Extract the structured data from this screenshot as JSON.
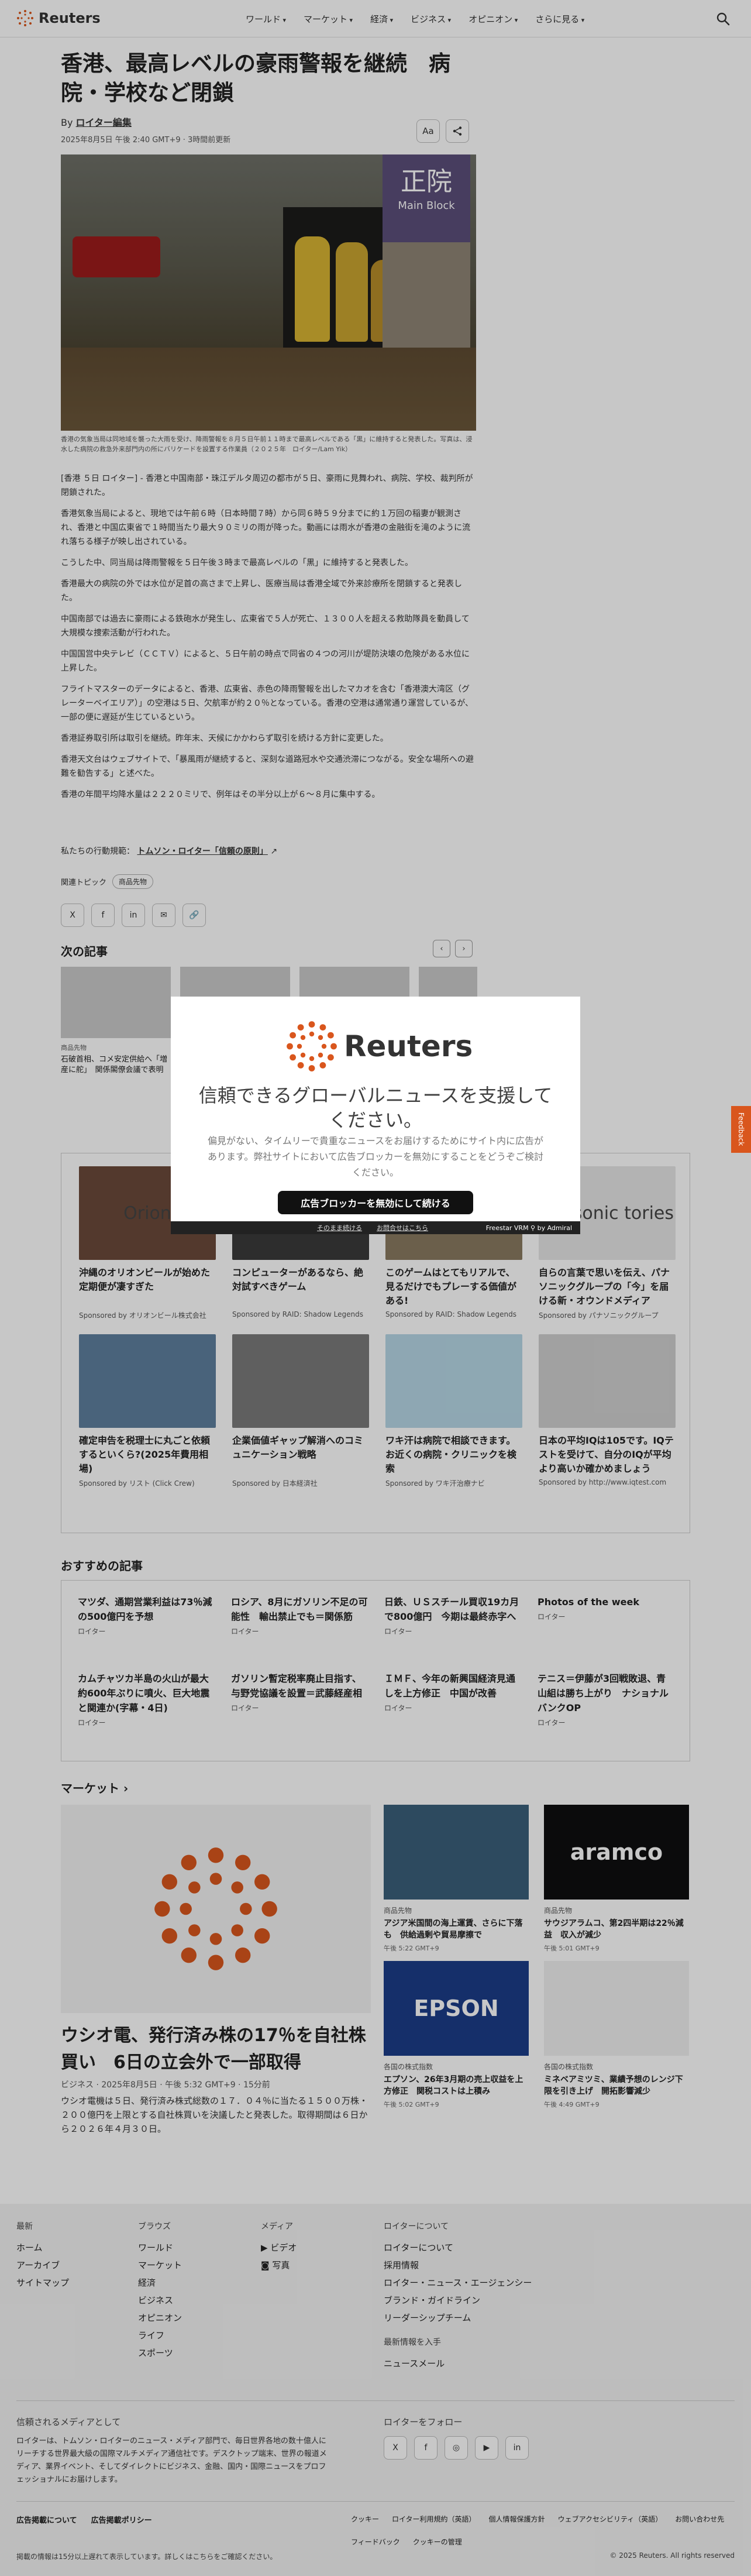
{
  "header": {
    "logo": "Reuters",
    "menu": [
      "ワールド",
      "マーケット",
      "経済",
      "ビジネス",
      "オピニオン",
      "さらに見る"
    ]
  },
  "article": {
    "title": "香港、最高レベルの豪雨警報を継続　病院・学校など閉鎖",
    "by": "By",
    "author": "ロイター編集",
    "date": "2025年8月5日 午後 2:40 GMT+9 · 3時間前更新",
    "text_size": "Aa",
    "caption": "香港の気象当局は同地域を襲った大雨を受け、降雨警報を８月５日午前１１時まで最高レベルである「黒」に維持すると発表した。写真は、浸水した病院の救急外来部門内の所にバリケードを設置する作業員（２０２５年　ロイター/Lam Yik）",
    "paragraphs": [
      "[香港 ５日 ロイター] - 香港と中国南部・珠江デルタ周辺の都市が５日、豪雨に見舞われ、病院、学校、裁判所が閉鎖された。",
      "香港気象当局によると、現地では午前６時（日本時間７時）から同６時５９分までに約１万回の稲妻が観測され、香港と中国広東省で１時間当たり最大９０ミリの雨が降った。動画には雨水が香港の金融街を滝のように流れ落ちる様子が映し出されている。",
      "こうした中、同当局は降雨警報を５日午後３時まで最高レベルの「黒」に維持すると発表した。",
      "香港最大の病院の外では水位が足首の高さまで上昇し、医療当局は香港全域で外来診療所を閉鎖すると発表した。",
      "中国南部では過去に豪雨による鉄砲水が発生し、広東省で５人が死亡、１３００人を超える救助隊員を動員して大規模な捜索活動が行われた。",
      "中国国営中央テレビ（ＣＣＴＶ）によると、５日午前の時点で同省の４つの河川が堤防決壊の危険がある水位に上昇した。",
      "フライトマスターのデータによると、香港、広東省、赤色の降雨警報を出したマカオを含む「香港澳大湾区（グレーターベイエリア）」の空港は５日、欠航率が約２０％となっている。香港の空港は通常通り運営しているが、一部の便に遅延が生じているという。",
      "香港証券取引所は取引を継続。昨年末、天候にかかわらず取引を続ける方針に変更した。",
      "香港天文台はウェブサイトで、「暴風雨が継続すると、深刻な道路冠水や交通渋滞につながる。安全な場所への避難を勧告する」と述べた。",
      "香港の年間平均降水量は２２２０ミリで、例年はその半分以上が６～８月に集中する。"
    ],
    "trust_prefix": "私たちの行動規範：",
    "trust_link": "トムソン・ロイター「信頼の原則」",
    "topics_label": "関連トピック",
    "topic": "商品先物",
    "share_icons": [
      "X",
      "f",
      "in",
      "✉",
      "🔗"
    ]
  },
  "next": {
    "heading": "次の記事",
    "cards": [
      {
        "kicker": "商品先物",
        "title": "石破首相、コメ安定供給へ「増産に舵」　関係閣僚会議で表明"
      },
      {
        "kicker": "",
        "title": ""
      },
      {
        "kicker": "",
        "title": ""
      },
      {
        "kicker": "",
        "title": ""
      }
    ]
  },
  "ads": [
    {
      "title": "沖縄のオリオンビールが始めた定期便が凄すぎた",
      "sponsor": "Sponsored by オリオンビール株式会社",
      "color": "#6b4a3a",
      "label": "Orion"
    },
    {
      "title": "コンピューターがあるなら、絶対試すべきゲーム",
      "sponsor": "Sponsored by RAID: Shadow Legends",
      "color": "#3a3a3a",
      "label": ""
    },
    {
      "title": "このゲームはとてもリアルで、見るだけでもプレーする価値がある!",
      "sponsor": "Sponsored by RAID: Shadow Legends",
      "color": "#8a7a60",
      "label": ""
    },
    {
      "title": "自らの言葉で思いを伝え、パナソニックグループの「今」を届ける新・オウンドメディア",
      "sponsor": "Sponsored by パナソニックグループ",
      "color": "#e6e6e6",
      "label": "anasonic tories"
    },
    {
      "title": "確定申告を税理士に丸ごと依頼するといくら?(2025年費用相場)",
      "sponsor": "Sponsored by リスト (Click Crew)",
      "color": "#5e7f9e",
      "label": ""
    },
    {
      "title": "企業価値ギャップ解消へのコミュニケーション戦略",
      "sponsor": "Sponsored by 日本経済社",
      "color": "#7a7a7a",
      "label": ""
    },
    {
      "title": "ワキ汗は病院で相談できます。お近くの病院・クリニックを検索",
      "sponsor": "Sponsored by ワキ汗治療ナビ",
      "color": "#b6d7e6",
      "label": ""
    },
    {
      "title": "日本の平均IQは105です。IQテストを受けて、自分のIQが平均より高いか確かめましょう",
      "sponsor": "Sponsored by http://www.iqtest.com",
      "color": "#cfcfcf",
      "label": ""
    }
  ],
  "recs": {
    "heading": "おすすめの記事",
    "items": [
      {
        "title": "マツダ、通期営業利益は73％減の500億円を予想",
        "source": "ロイター"
      },
      {
        "title": "ロシア、8月にガソリン不足の可能性　輸出禁止でも＝関係筋",
        "source": "ロイター"
      },
      {
        "title": "日鉄、ＵＳスチール買収19カ月で800億円　今期は最終赤字へ",
        "source": "ロイター"
      },
      {
        "title": "Photos of the week",
        "source": "ロイター"
      },
      {
        "title": "カムチャツカ半島の火山が最大約600年ぶりに噴火、巨大地震と関連か(字幕・4日)",
        "source": "ロイター"
      },
      {
        "title": "ガソリン暫定税率廃止目指す、与野党協議を設置＝武藤経産相",
        "source": "ロイター"
      },
      {
        "title": "ＩＭＦ、今年の新興国経済見通しを上方修正　中国が改善",
        "source": "ロイター"
      },
      {
        "title": "テニス＝伊藤が3回戦敗退、青山組は勝ち上がり　ナショナルバンクOP",
        "source": "ロイター"
      }
    ]
  },
  "markets": {
    "heading": "マーケット ›",
    "main_title": "ウシオ電、発行済み株の17％を自社株買い　6日の立会外で一部取得",
    "main_meta": "ビジネス · 2025年8月5日 · 午後 5:32 GMT+9 · 15分前",
    "main_desc": "ウシオ電機は５日、発行済み株式総数の１７．０４％に当たる１５００万株・２００億円を上限とする自社株買いを決議したと発表した。取得期間は６日から２０２６年４月３０日。",
    "cards": [
      {
        "kicker": "商品先物",
        "title": "アジア米国間の海上運賃、さらに下落も　供給過剰や貿易摩擦で",
        "date": "午後 5:22 GMT+9",
        "color": "#3a5f7a",
        "label": ""
      },
      {
        "kicker": "商品先物",
        "title": "サウジアラムコ、第2四半期は22％減益　収入が減少",
        "date": "午後 5:01 GMT+9",
        "color": "#0f0f10",
        "label": "aramco"
      },
      {
        "kicker": "各国の株式指数",
        "title": "エプソン、26年3月期の売上収益を上方修正　関税コストは上積み",
        "date": "午後 5:02 GMT+9",
        "color": "#1c3d88",
        "label": "EPSON"
      },
      {
        "kicker": "各国の株式指数",
        "title": "ミネベアミツミ、業績予想のレンジ下限を引き上げ　開拓影響減少",
        "date": "午後 4:49 GMT+9",
        "color": "#f0f0f0",
        "label": ""
      }
    ]
  },
  "footer": {
    "col1": {
      "title": "最新",
      "links": [
        "ホーム",
        "アーカイブ",
        "サイトマップ"
      ]
    },
    "col2": {
      "title": "ブラウズ",
      "links": [
        "ワールド",
        "マーケット",
        "経済",
        "ビジネス",
        "オピニオン",
        "ライフ",
        "スポーツ"
      ]
    },
    "col3": {
      "title": "メディア",
      "links": [
        "ビデオ",
        "写真"
      ]
    },
    "col4": {
      "title": "ロイターについて",
      "links": [
        "ロイターについて",
        "採用情報",
        "ロイター・ニュース・エージェンシー",
        "ブランド・ガイドライン",
        "リーダーシップチーム"
      ]
    },
    "col4b": {
      "title": "最新情報を入手",
      "links": [
        "ニュースメール"
      ]
    },
    "trust_title": "信頼されるメディアとして",
    "trust_text": "ロイターは、トムソン・ロイターのニュース・メディア部門で、毎日世界各地の数十億人にリーチする世界最大級の国際マルチメディア通信社です。デスクトップ端末、世界の報道メディア、業界イベント、そしてダイレクトにビジネス、金融、国内・国際ニュースをプロフェッショナルにお届けします。",
    "follow_title": "ロイターをフォロー",
    "follow_icons": [
      "X",
      "f",
      "◎",
      "▶",
      "in"
    ],
    "legal1": [
      "広告掲載について",
      "広告掲載ポリシー"
    ],
    "legal2": [
      "クッキー",
      "ロイター利用規約（英語）",
      "個人情報保護方針",
      "ウェブアクセシビリティ（英語）",
      "お問い合わせ先",
      "フィードバック",
      "クッキーの管理"
    ],
    "note": "掲載の情報は15分以上遅れて表示しています。詳しくはこちらをご確認ください。",
    "copyright": "© 2025 Reuters. All rights reserved"
  },
  "modal": {
    "logo": "Reuters",
    "heading": "信頼できるグローバルニュースを支援してください。",
    "desc": "偏見がない、タイムリーで貴重なニュースをお届けするためにサイト内に広告があります。弊社サイトにおいて広告ブロッカーを無効にすることをどうぞご検討ください。",
    "button": "広告ブロッカーを無効にして続ける",
    "link1": "そのまま続ける",
    "link2": "お問合せはこちら",
    "brand": "Freestar VRM ⚲ by Admiral"
  },
  "feedback": "Feedback",
  "colors": {
    "brand": "#d9561d",
    "ink": "#222222"
  }
}
